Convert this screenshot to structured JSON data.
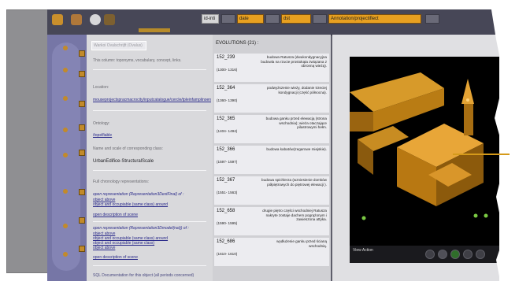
{
  "toolbar": {
    "id_button": "id-inti",
    "select_a": "date",
    "select_b": "dst",
    "select_c": "Annotation/projectiflect"
  },
  "info": {
    "title_box": "Warkoi Ovalschrijft (Ovalus)",
    "description": "This column: toponyms, vocabulary, concept, links.",
    "location_label": "Location:",
    "location_link": "mouseprojectspracmacrocity/inputcatalogue/cercle/tpleinfamplinoentity",
    "ontology_label": "Ontology:",
    "ontology_link": "/topelfiable",
    "name_label": "Name and scale of corresponding class:",
    "class_name": "UrbanEdifice-StructuralScale",
    "full_chron_label": "Full chronology representations:",
    "rep1_text": "open representation (Representation3DextFinal) of :",
    "rep1_links": [
      "object above",
      "object and occupiable (same class) around"
    ],
    "scene_link_1": "open description of scene",
    "rep2_text": "open representation (Representation3Dmodel(nat)) of :",
    "rep2_links": [
      "object above",
      "object and occupiable (same class) around",
      "object and occupiable (same class)",
      "object above"
    ],
    "scene_link_2": "open description of scene",
    "footer": "SQL Documentation for this object (all periods concerned)"
  },
  "evolutions": {
    "title": "EVOLUTIONS (21) :",
    "items": [
      {
        "id": "152_239",
        "dates": "(1300- 1316)",
        "desc": "budowa Ratusza (dwukondygnacyjna budowla na rzucie prostokąta związana z obronną wieżą)."
      },
      {
        "id": "152_364",
        "dates": "(1360- 1390)",
        "desc": "podwyższenie wieży, dodanie trzeciej kondygnacji (część północna)."
      },
      {
        "id": "152_365",
        "dates": "(1404- 1494)",
        "desc": "budowa ganku przed elewacją (strona wschodnia); wieża otaczające pilastrowymi hełm."
      },
      {
        "id": "152_366",
        "dates": "(1597- 1597)",
        "desc": "budowa kabatów(zegarowe miejskie)."
      },
      {
        "id": "152_367",
        "dates": "(1551- 1563)",
        "desc": "budowa spichlerza (wzniesienie domków półpiętrowych do piętrowej elewacji )."
      },
      {
        "id": "152_658",
        "dates": "(1590- 1595)",
        "desc": "drugie piętro części wschodniej Ratusza nakryte zostaje dachem pogrążonym i zawieszona attyka."
      },
      {
        "id": "152_686",
        "dates": "(1610- 1610)",
        "desc": "wydłużenie ganku przed ścianą wschodnią."
      }
    ]
  },
  "viewer": {
    "label": "View Action"
  }
}
